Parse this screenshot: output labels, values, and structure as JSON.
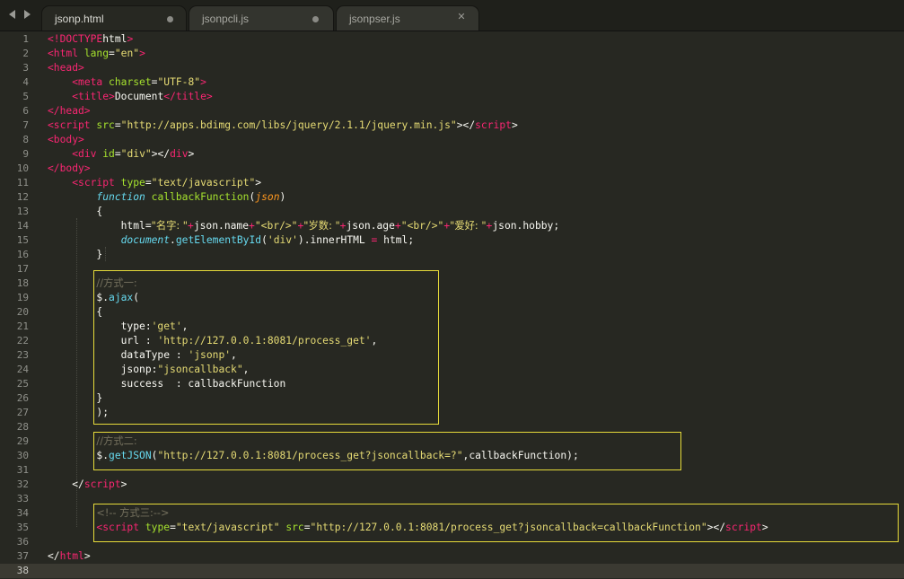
{
  "tabs": [
    {
      "label": "jsonp.html",
      "active": true,
      "indicator": "dot"
    },
    {
      "label": "jsonpcli.js",
      "active": false,
      "indicator": "dot"
    },
    {
      "label": "jsonpser.js",
      "active": false,
      "indicator": "close"
    }
  ],
  "editor": {
    "current_line": 38,
    "line_numbers": [
      "1",
      "2",
      "3",
      "4",
      "5",
      "6",
      "7",
      "8",
      "9",
      "10",
      "11",
      "12",
      "13",
      "14",
      "15",
      "16",
      "17",
      "18",
      "19",
      "20",
      "21",
      "22",
      "23",
      "24",
      "25",
      "26",
      "27",
      "28",
      "29",
      "30",
      "31",
      "32",
      "33",
      "34",
      "35",
      "36",
      "37",
      "38"
    ],
    "lines": [
      [
        [
          "tg",
          "<!"
        ],
        [
          "tg",
          "DOCTYPE"
        ],
        [
          "",
          "html"
        ],
        [
          "tg",
          ">"
        ]
      ],
      [
        [
          "tg",
          "<html"
        ],
        [
          "",
          " "
        ],
        [
          "at",
          "lang"
        ],
        [
          "",
          "="
        ],
        [
          "st",
          "\"en\""
        ],
        [
          "tg",
          ">"
        ]
      ],
      [
        [
          "tg",
          "<head>"
        ]
      ],
      [
        [
          "",
          "    "
        ],
        [
          "tg",
          "<meta"
        ],
        [
          "",
          " "
        ],
        [
          "at",
          "charset"
        ],
        [
          "",
          "="
        ],
        [
          "st",
          "\"UTF-8\""
        ],
        [
          "tg",
          ">"
        ]
      ],
      [
        [
          "",
          "    "
        ],
        [
          "tg",
          "<title"
        ],
        [
          "tg",
          ">"
        ],
        [
          "",
          "Document"
        ],
        [
          "tg",
          "</title"
        ],
        [
          "tg",
          ">"
        ]
      ],
      [
        [
          "tg",
          "</head>"
        ]
      ],
      [
        [
          "tg",
          "<script"
        ],
        [
          "",
          " "
        ],
        [
          "at",
          "src"
        ],
        [
          "",
          "="
        ],
        [
          "st",
          "\"http://apps.bdimg.com/libs/jquery/2.1.1/jquery.min.js\""
        ],
        [
          "",
          "></"
        ],
        [
          "tg",
          "script"
        ],
        [
          "",
          ">"
        ]
      ],
      [
        [
          "tg",
          "<body>"
        ]
      ],
      [
        [
          "",
          "    "
        ],
        [
          "tg",
          "<div"
        ],
        [
          "",
          " "
        ],
        [
          "at",
          "id"
        ],
        [
          "",
          "="
        ],
        [
          "st",
          "\"div\""
        ],
        [
          "",
          "></"
        ],
        [
          "tg",
          "div"
        ],
        [
          "",
          ">"
        ]
      ],
      [
        [
          "tg",
          "</body>"
        ]
      ],
      [
        [
          "",
          "    "
        ],
        [
          "tg",
          "<script"
        ],
        [
          "",
          " "
        ],
        [
          "at",
          "type"
        ],
        [
          "",
          "="
        ],
        [
          "st",
          "\"text/javascript\""
        ],
        [
          "",
          ">"
        ]
      ],
      [
        [
          "",
          "        "
        ],
        [
          "kw",
          "function"
        ],
        [
          "",
          " "
        ],
        [
          "fn",
          "callbackFunction"
        ],
        [
          "",
          "("
        ],
        [
          "pr",
          "json"
        ],
        [
          "",
          ")"
        ]
      ],
      [
        [
          "",
          "        {"
        ]
      ],
      [
        [
          "",
          "            html="
        ],
        [
          "st",
          "\"名字: \""
        ],
        [
          "op",
          "+"
        ],
        [
          "",
          "json.name"
        ],
        [
          "op",
          "+"
        ],
        [
          "st",
          "\"<br/>\""
        ],
        [
          "op",
          "+"
        ],
        [
          "st",
          "\"岁数: \""
        ],
        [
          "op",
          "+"
        ],
        [
          "",
          "json.age"
        ],
        [
          "op",
          "+"
        ],
        [
          "st",
          "\"<br/>\""
        ],
        [
          "op",
          "+"
        ],
        [
          "st",
          "\"爱好: \""
        ],
        [
          "op",
          "+"
        ],
        [
          "",
          "json.hobby;"
        ]
      ],
      [
        [
          "",
          "            "
        ],
        [
          "kw",
          "document"
        ],
        [
          "",
          "."
        ],
        [
          "bi",
          "getElementById"
        ],
        [
          "",
          "("
        ],
        [
          "st",
          "'div'"
        ],
        [
          "",
          ").innerHTML "
        ],
        [
          "op",
          "="
        ],
        [
          "",
          " html;"
        ]
      ],
      [
        [
          "",
          "        }"
        ]
      ],
      [],
      [
        [
          "",
          "        "
        ],
        [
          "cm",
          "//方式一:"
        ]
      ],
      [
        [
          "",
          "        $."
        ],
        [
          "bi",
          "ajax"
        ],
        [
          "",
          "("
        ]
      ],
      [
        [
          "",
          "        {"
        ]
      ],
      [
        [
          "",
          "            type:"
        ],
        [
          "st",
          "'get'"
        ],
        [
          "",
          ","
        ]
      ],
      [
        [
          "",
          "            url : "
        ],
        [
          "st",
          "'http://127.0.0.1:8081/process_get'"
        ],
        [
          "",
          ","
        ]
      ],
      [
        [
          "",
          "            dataType : "
        ],
        [
          "st",
          "'jsonp'"
        ],
        [
          "",
          ","
        ]
      ],
      [
        [
          "",
          "            jsonp:"
        ],
        [
          "st",
          "\"jsoncallback\""
        ],
        [
          "",
          ","
        ]
      ],
      [
        [
          "",
          "            success  : callbackFunction"
        ]
      ],
      [
        [
          "",
          "        }"
        ]
      ],
      [
        [
          "",
          "        );"
        ]
      ],
      [],
      [
        [
          "",
          "        "
        ],
        [
          "cm",
          "//方式二:"
        ]
      ],
      [
        [
          "",
          "        $."
        ],
        [
          "bi",
          "getJSON"
        ],
        [
          "",
          "("
        ],
        [
          "st",
          "\"http://127.0.0.1:8081/process_get?jsoncallback=?\""
        ],
        [
          "",
          ",callbackFunction);"
        ]
      ],
      [],
      [
        [
          "",
          "    </"
        ],
        [
          "tg",
          "script"
        ],
        [
          "",
          ">"
        ]
      ],
      [],
      [
        [
          "",
          "        "
        ],
        [
          "cm",
          "<!-- 方式三:-->"
        ]
      ],
      [
        [
          "",
          "        "
        ],
        [
          "tg",
          "<script"
        ],
        [
          "",
          " "
        ],
        [
          "at",
          "type"
        ],
        [
          "",
          "="
        ],
        [
          "st",
          "\"text/javascript\""
        ],
        [
          "",
          " "
        ],
        [
          "at",
          "src"
        ],
        [
          "",
          "="
        ],
        [
          "st",
          "\"http://127.0.0.1:8081/process_get?jsoncallback=callbackFunction\""
        ],
        [
          "",
          "></"
        ],
        [
          "tg",
          "script"
        ],
        [
          "",
          ">"
        ]
      ],
      [],
      [
        [
          "",
          "</"
        ],
        [
          "tg",
          "html"
        ],
        [
          "",
          ">"
        ]
      ],
      []
    ]
  },
  "colors": {
    "background": "#272822",
    "highlight_box": "#e6db3a",
    "tag": "#f92672",
    "attribute": "#a6e22e",
    "string": "#e6db74",
    "comment": "#75715e"
  }
}
